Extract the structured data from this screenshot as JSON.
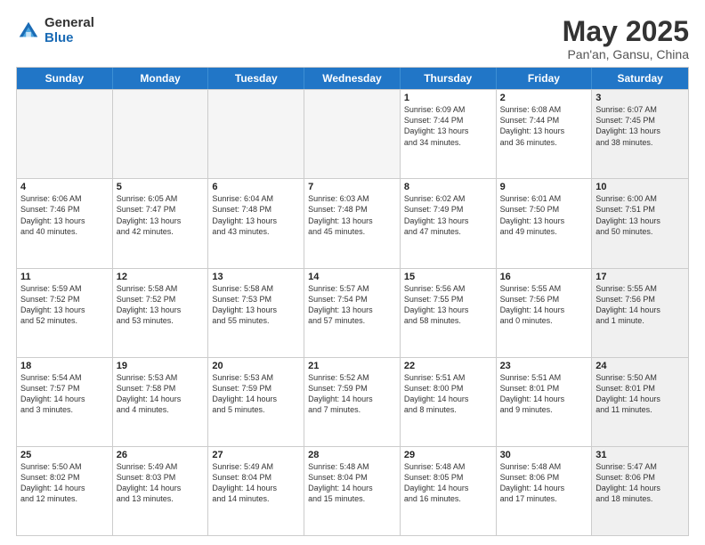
{
  "logo": {
    "general": "General",
    "blue": "Blue"
  },
  "title": "May 2025",
  "location": "Pan'an, Gansu, China",
  "days": [
    "Sunday",
    "Monday",
    "Tuesday",
    "Wednesday",
    "Thursday",
    "Friday",
    "Saturday"
  ],
  "weeks": [
    [
      {
        "day": "",
        "info": "",
        "empty": true
      },
      {
        "day": "",
        "info": "",
        "empty": true
      },
      {
        "day": "",
        "info": "",
        "empty": true
      },
      {
        "day": "",
        "info": "",
        "empty": true
      },
      {
        "day": "1",
        "info": "Sunrise: 6:09 AM\nSunset: 7:44 PM\nDaylight: 13 hours\nand 34 minutes.",
        "empty": false
      },
      {
        "day": "2",
        "info": "Sunrise: 6:08 AM\nSunset: 7:44 PM\nDaylight: 13 hours\nand 36 minutes.",
        "empty": false
      },
      {
        "day": "3",
        "info": "Sunrise: 6:07 AM\nSunset: 7:45 PM\nDaylight: 13 hours\nand 38 minutes.",
        "empty": false,
        "shaded": true
      }
    ],
    [
      {
        "day": "4",
        "info": "Sunrise: 6:06 AM\nSunset: 7:46 PM\nDaylight: 13 hours\nand 40 minutes.",
        "empty": false
      },
      {
        "day": "5",
        "info": "Sunrise: 6:05 AM\nSunset: 7:47 PM\nDaylight: 13 hours\nand 42 minutes.",
        "empty": false
      },
      {
        "day": "6",
        "info": "Sunrise: 6:04 AM\nSunset: 7:48 PM\nDaylight: 13 hours\nand 43 minutes.",
        "empty": false
      },
      {
        "day": "7",
        "info": "Sunrise: 6:03 AM\nSunset: 7:48 PM\nDaylight: 13 hours\nand 45 minutes.",
        "empty": false
      },
      {
        "day": "8",
        "info": "Sunrise: 6:02 AM\nSunset: 7:49 PM\nDaylight: 13 hours\nand 47 minutes.",
        "empty": false
      },
      {
        "day": "9",
        "info": "Sunrise: 6:01 AM\nSunset: 7:50 PM\nDaylight: 13 hours\nand 49 minutes.",
        "empty": false
      },
      {
        "day": "10",
        "info": "Sunrise: 6:00 AM\nSunset: 7:51 PM\nDaylight: 13 hours\nand 50 minutes.",
        "empty": false,
        "shaded": true
      }
    ],
    [
      {
        "day": "11",
        "info": "Sunrise: 5:59 AM\nSunset: 7:52 PM\nDaylight: 13 hours\nand 52 minutes.",
        "empty": false
      },
      {
        "day": "12",
        "info": "Sunrise: 5:58 AM\nSunset: 7:52 PM\nDaylight: 13 hours\nand 53 minutes.",
        "empty": false
      },
      {
        "day": "13",
        "info": "Sunrise: 5:58 AM\nSunset: 7:53 PM\nDaylight: 13 hours\nand 55 minutes.",
        "empty": false
      },
      {
        "day": "14",
        "info": "Sunrise: 5:57 AM\nSunset: 7:54 PM\nDaylight: 13 hours\nand 57 minutes.",
        "empty": false
      },
      {
        "day": "15",
        "info": "Sunrise: 5:56 AM\nSunset: 7:55 PM\nDaylight: 13 hours\nand 58 minutes.",
        "empty": false
      },
      {
        "day": "16",
        "info": "Sunrise: 5:55 AM\nSunset: 7:56 PM\nDaylight: 14 hours\nand 0 minutes.",
        "empty": false
      },
      {
        "day": "17",
        "info": "Sunrise: 5:55 AM\nSunset: 7:56 PM\nDaylight: 14 hours\nand 1 minute.",
        "empty": false,
        "shaded": true
      }
    ],
    [
      {
        "day": "18",
        "info": "Sunrise: 5:54 AM\nSunset: 7:57 PM\nDaylight: 14 hours\nand 3 minutes.",
        "empty": false
      },
      {
        "day": "19",
        "info": "Sunrise: 5:53 AM\nSunset: 7:58 PM\nDaylight: 14 hours\nand 4 minutes.",
        "empty": false
      },
      {
        "day": "20",
        "info": "Sunrise: 5:53 AM\nSunset: 7:59 PM\nDaylight: 14 hours\nand 5 minutes.",
        "empty": false
      },
      {
        "day": "21",
        "info": "Sunrise: 5:52 AM\nSunset: 7:59 PM\nDaylight: 14 hours\nand 7 minutes.",
        "empty": false
      },
      {
        "day": "22",
        "info": "Sunrise: 5:51 AM\nSunset: 8:00 PM\nDaylight: 14 hours\nand 8 minutes.",
        "empty": false
      },
      {
        "day": "23",
        "info": "Sunrise: 5:51 AM\nSunset: 8:01 PM\nDaylight: 14 hours\nand 9 minutes.",
        "empty": false
      },
      {
        "day": "24",
        "info": "Sunrise: 5:50 AM\nSunset: 8:01 PM\nDaylight: 14 hours\nand 11 minutes.",
        "empty": false,
        "shaded": true
      }
    ],
    [
      {
        "day": "25",
        "info": "Sunrise: 5:50 AM\nSunset: 8:02 PM\nDaylight: 14 hours\nand 12 minutes.",
        "empty": false
      },
      {
        "day": "26",
        "info": "Sunrise: 5:49 AM\nSunset: 8:03 PM\nDaylight: 14 hours\nand 13 minutes.",
        "empty": false
      },
      {
        "day": "27",
        "info": "Sunrise: 5:49 AM\nSunset: 8:04 PM\nDaylight: 14 hours\nand 14 minutes.",
        "empty": false
      },
      {
        "day": "28",
        "info": "Sunrise: 5:48 AM\nSunset: 8:04 PM\nDaylight: 14 hours\nand 15 minutes.",
        "empty": false
      },
      {
        "day": "29",
        "info": "Sunrise: 5:48 AM\nSunset: 8:05 PM\nDaylight: 14 hours\nand 16 minutes.",
        "empty": false
      },
      {
        "day": "30",
        "info": "Sunrise: 5:48 AM\nSunset: 8:06 PM\nDaylight: 14 hours\nand 17 minutes.",
        "empty": false
      },
      {
        "day": "31",
        "info": "Sunrise: 5:47 AM\nSunset: 8:06 PM\nDaylight: 14 hours\nand 18 minutes.",
        "empty": false,
        "shaded": true
      }
    ]
  ]
}
